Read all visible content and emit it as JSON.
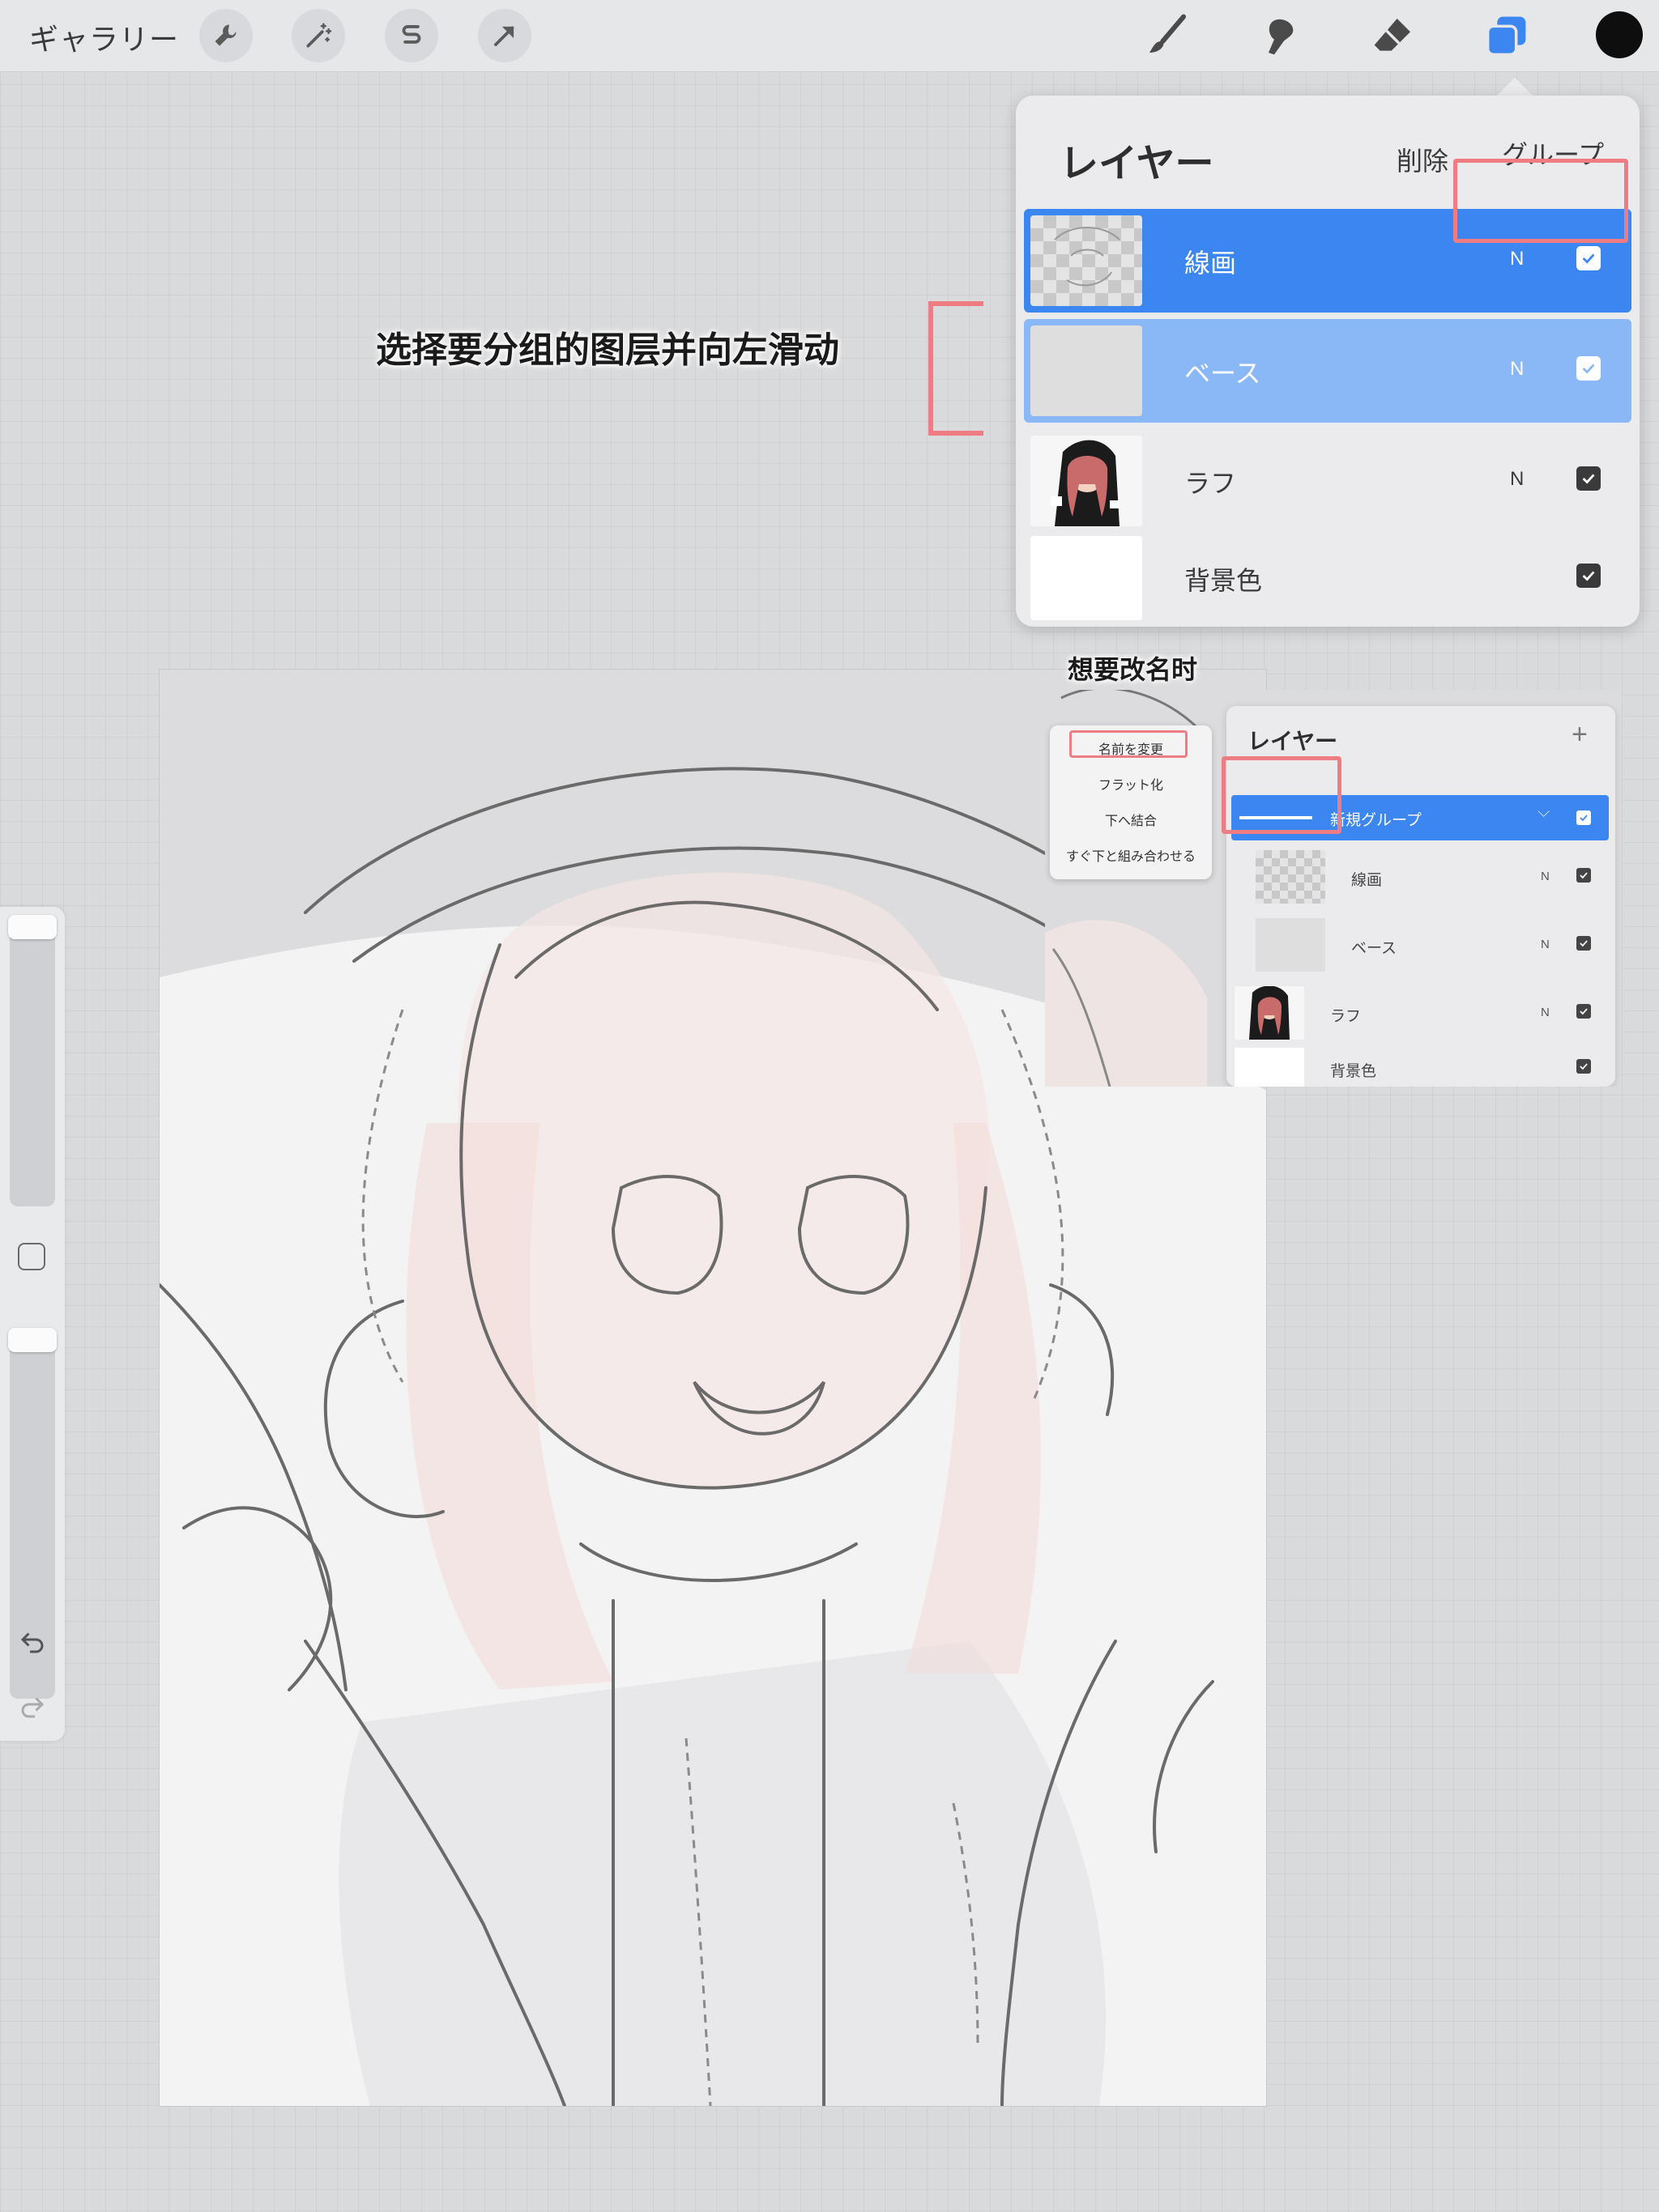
{
  "toolbar": {
    "gallery_label": "ギャラリー",
    "left_tools": [
      "wrench-icon",
      "magic-wand-icon",
      "selection-s-icon",
      "transform-arrow-icon"
    ],
    "right_tools": [
      "brush-icon",
      "smudge-icon",
      "eraser-icon",
      "layers-icon"
    ],
    "active_tool": "layers-icon",
    "current_color": "#0e0e0e",
    "accent": "#3b86f0"
  },
  "sidebar": {
    "size_slider_level": 0.95,
    "opacity_slider_level": 0.95,
    "icons": [
      "modify-square-icon",
      "undo-icon",
      "redo-icon"
    ]
  },
  "layers_panel": {
    "title": "レイヤー",
    "delete_label": "削除",
    "group_label": "グループ",
    "layers": [
      {
        "name": "線画",
        "blend": "N",
        "visible": true,
        "state": "selected-primary",
        "thumb": "checker-sketch"
      },
      {
        "name": "ベース",
        "blend": "N",
        "visible": true,
        "state": "selected-secondary",
        "thumb": "blank"
      },
      {
        "name": "ラフ",
        "blend": "N",
        "visible": true,
        "state": "normal",
        "thumb": "character"
      },
      {
        "name": "背景色",
        "blend": "",
        "visible": true,
        "state": "normal",
        "thumb": "white"
      }
    ]
  },
  "annotations": {
    "swipe_instruction": "选择要分组的图层并向左滑动",
    "rename_heading": "想要改名时",
    "highlight_color": "#f07c83"
  },
  "inset": {
    "context_menu": [
      "名前を変更",
      "フラット化",
      "下へ結合",
      "すぐ下と組み合わせる"
    ],
    "highlighted_menu_item": "名前を変更",
    "panel_title": "レイヤー",
    "add_symbol": "+",
    "group_row": {
      "name": "新規グループ",
      "visible": true
    },
    "rows": [
      {
        "name": "線画",
        "blend": "N",
        "visible": true
      },
      {
        "name": "ベース",
        "blend": "N",
        "visible": true
      },
      {
        "name": "ラフ",
        "blend": "N",
        "visible": true
      },
      {
        "name": "背景色",
        "blend": "",
        "visible": true
      }
    ]
  }
}
